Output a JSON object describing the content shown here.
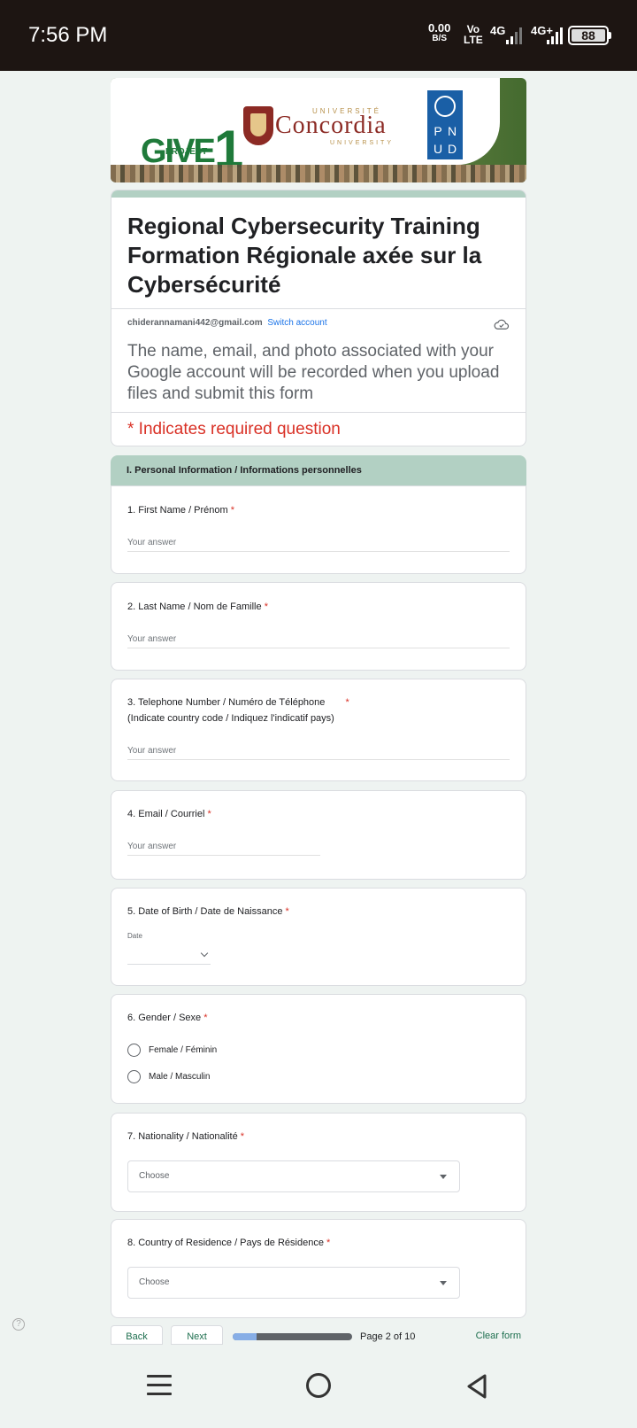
{
  "status_bar": {
    "time": "7:56 PM",
    "net_speed": "0.00",
    "net_unit": "B/S",
    "volte_top": "Vo",
    "volte_bottom": "LTE",
    "network1": "4G",
    "network2": "4G+",
    "battery": "88"
  },
  "header": {
    "give_text": "GIVE",
    "give_number": "1",
    "give_sub": "PROJECT",
    "univ_top": "UNIVERSITÉ",
    "concordia": "Concordia",
    "univ_bottom": "UNIVERSITY",
    "undp_letters": [
      "P",
      "N",
      "U",
      "D"
    ]
  },
  "form": {
    "title": "Regional Cybersecurity Training Formation Régionale axée sur la Cybersécurité",
    "account_email": "chiderannamani442@gmail.com",
    "switch_account": "Switch account",
    "notice": "The name, email, and photo associated with your Google account will be recorded when you upload files and submit this form",
    "required_note": "* Indicates required question"
  },
  "section": {
    "title": "I. Personal Information / Informations personnelles"
  },
  "questions": {
    "q1": {
      "label": "1. First Name / Prénom",
      "placeholder": "Your answer"
    },
    "q2": {
      "label": "2. Last Name / Nom de Famille",
      "placeholder": "Your answer"
    },
    "q3": {
      "label": "3. Telephone Number / Numéro de Téléphone",
      "sublabel": "(Indicate country code / Indiquez l'indicatif pays)",
      "placeholder": "Your answer"
    },
    "q4": {
      "label": "4. Email / Courriel",
      "placeholder": "Your answer"
    },
    "q5": {
      "label": "5. Date of Birth / Date de Naissance",
      "date_label": "Date"
    },
    "q6": {
      "label": "6. Gender / Sexe",
      "options": [
        "Female / Féminin",
        "Male / Masculin"
      ]
    },
    "q7": {
      "label": "7. Nationality / Nationalité",
      "placeholder": "Choose"
    },
    "q8": {
      "label": "8. Country of Residence / Pays de Résidence",
      "placeholder": "Choose"
    }
  },
  "required_mark": "*",
  "navigation": {
    "back": "Back",
    "next": "Next",
    "page_indicator": "Page 2 of 10",
    "progress": 0.2,
    "clear": "Clear form"
  },
  "colors": {
    "accent": "#b2d0c3",
    "required": "#d93025",
    "link": "#1a73e8",
    "nav_text": "#1e6f4f"
  },
  "icons": [
    "cloud-icon",
    "chevron-down-icon",
    "dropdown-caret-icon",
    "help-icon",
    "menu-icon",
    "home-icon",
    "back-icon"
  ]
}
